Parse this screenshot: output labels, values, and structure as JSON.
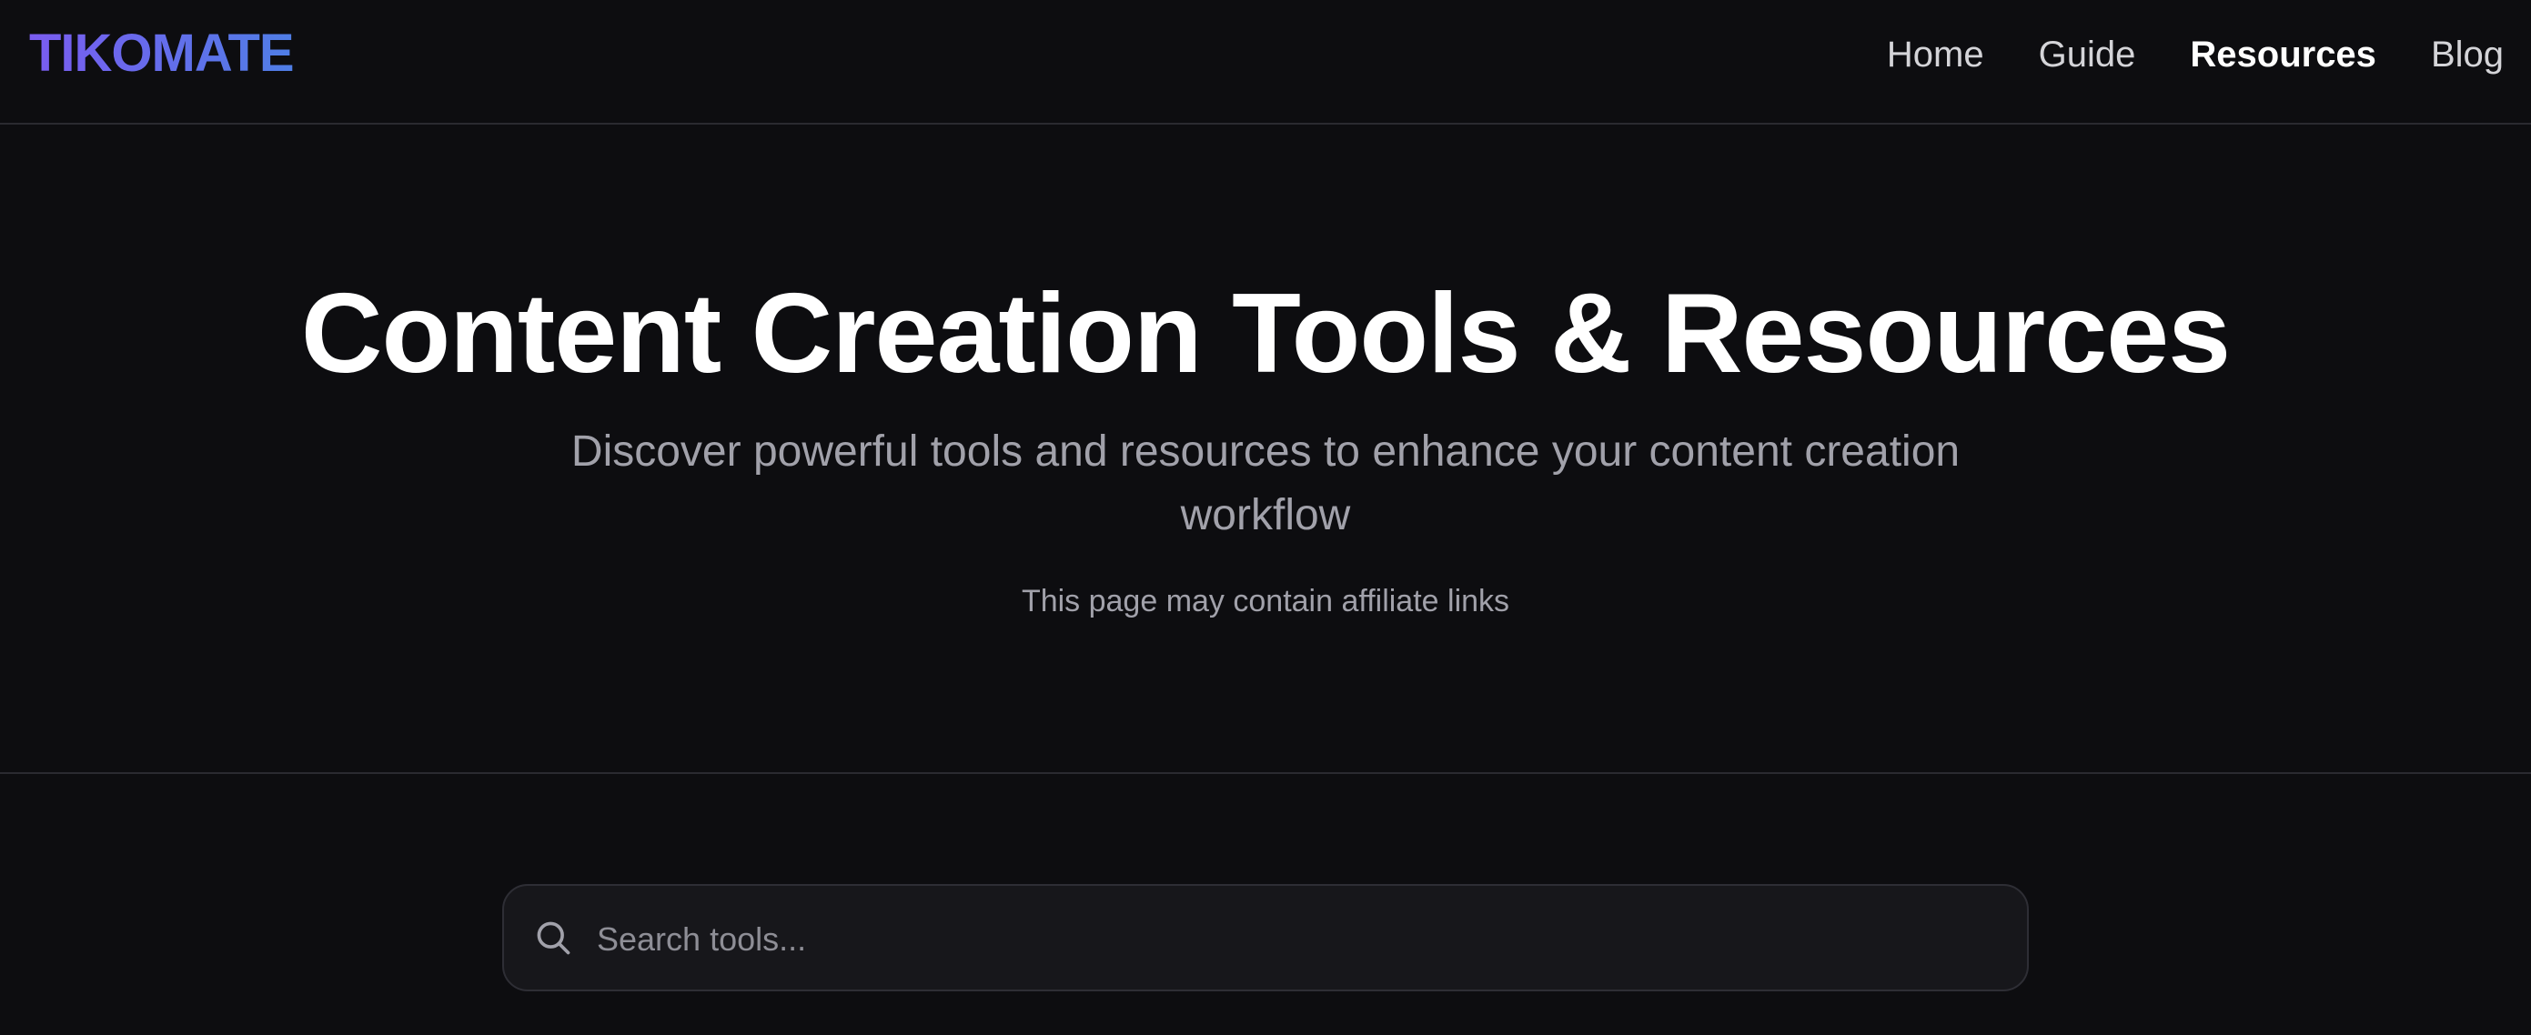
{
  "header": {
    "logo": "TIKOMATE",
    "nav": [
      {
        "label": "Home",
        "active": false
      },
      {
        "label": "Guide",
        "active": false
      },
      {
        "label": "Resources",
        "active": true
      },
      {
        "label": "Blog",
        "active": false
      }
    ]
  },
  "hero": {
    "title": "Content Creation Tools & Resources",
    "subtitle": "Discover powerful tools and resources to enhance your content creation workflow",
    "note": "This page may contain affiliate links"
  },
  "search": {
    "placeholder": "Search tools...",
    "value": "",
    "icon": "search-icon"
  },
  "colors": {
    "background": "#0d0d10",
    "logo_gradient_start": "#7a5cf0",
    "logo_gradient_end": "#4f7ee6",
    "divider": "#2a2a30",
    "muted_text": "#a1a1aa"
  }
}
